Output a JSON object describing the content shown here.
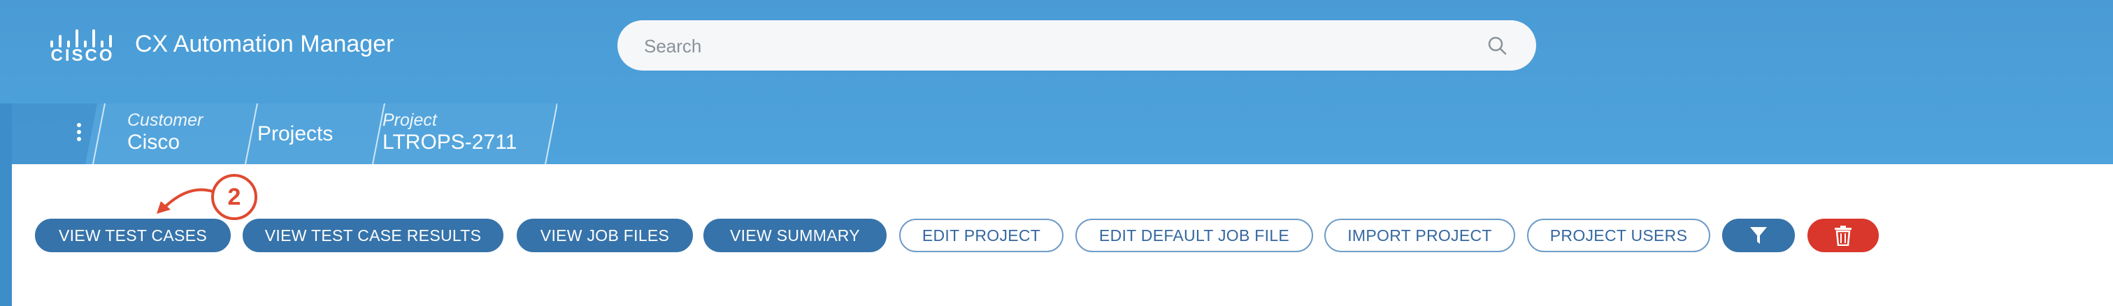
{
  "header": {
    "logo_text": "CISCO",
    "app_title": "CX Automation Manager",
    "search_placeholder": "Search"
  },
  "breadcrumb": {
    "menu_icon": "kebab-vertical-icon",
    "items": [
      {
        "label": "Customer",
        "value": "Cisco"
      },
      {
        "label": "",
        "value": "Projects"
      },
      {
        "label": "Project",
        "value": "LTROPS-2711"
      }
    ]
  },
  "toolbar": {
    "buttons": [
      {
        "label": "VIEW TEST CASES",
        "style": "solid"
      },
      {
        "label": "VIEW TEST CASE RESULTS",
        "style": "solid"
      },
      {
        "label": "VIEW JOB FILES",
        "style": "solid"
      },
      {
        "label": "VIEW SUMMARY",
        "style": "solid"
      },
      {
        "label": "EDIT PROJECT",
        "style": "outline"
      },
      {
        "label": "EDIT DEFAULT JOB FILE",
        "style": "outline"
      },
      {
        "label": "IMPORT PROJECT",
        "style": "outline"
      },
      {
        "label": "PROJECT USERS",
        "style": "outline"
      }
    ],
    "filter_icon": "filter-icon",
    "delete_icon": "trash-icon"
  },
  "annotation": {
    "step_number": "2"
  },
  "colors": {
    "header": "#4a9bd5",
    "primary_button": "#3673aa",
    "outline_border": "#6e9cc8",
    "danger": "#d9372b",
    "annotation": "#e04a30"
  }
}
